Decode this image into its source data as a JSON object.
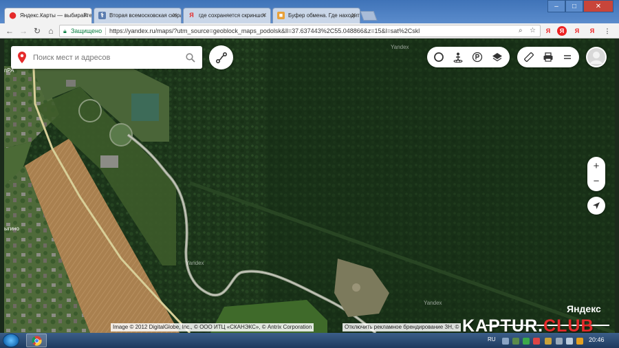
{
  "browser": {
    "tabs": [
      {
        "title": "Яндекс.Карты — выбирайте",
        "favicon": "yandex-maps-favicon",
        "active": true
      },
      {
        "title": "Вторая всемосковская скорая",
        "favicon": "site-favicon",
        "active": false
      },
      {
        "title": "где сохраняется скриншот",
        "favicon": "yandex-favicon",
        "active": false
      },
      {
        "title": "Буфер обмена. Где находится",
        "favicon": "site-favicon",
        "active": false
      }
    ],
    "close_glyph": "✕",
    "window_buttons": {
      "minimize": "–",
      "maximize": "□",
      "close": "✕"
    },
    "nav": {
      "back": "←",
      "forward": "→",
      "reload": "↻",
      "home": "⌂"
    },
    "security_label": "Защищено",
    "url": "https://yandex.ru/maps/?utm_source=geoblock_maps_podolsk&ll=37.637443%2C55.048866&z=15&l=sat%2Cskl",
    "extensions": [
      "Я",
      "Я",
      "Я",
      "Я"
    ],
    "menu_glyph": "⋮"
  },
  "map": {
    "search": {
      "placeholder": "Поиск мест и адресов"
    },
    "map_labels": {
      "village_top": "пРА",
      "village_left": "ыгино",
      "yandex_watermark": "Yandex"
    },
    "copyright": "Image © 2012 DigitalGlobe, Inc., © ООО ИТЦ «СКАНЭКС», © Antrix Corporation",
    "ad_note": "Отключить рекламное брендирование ЗН, ©",
    "logo": "Яндекс",
    "zoom": {
      "in": "+",
      "out": "−"
    },
    "colors": {
      "forest": "#1f3a1c",
      "field": "#b08553",
      "road": "#d8cf98",
      "accent_red": "#e52b2b"
    }
  },
  "watermark": {
    "prefix": "KAPTUR.",
    "suffix": "CLUB"
  },
  "taskbar": {
    "language": "RU",
    "time": "20:46"
  }
}
